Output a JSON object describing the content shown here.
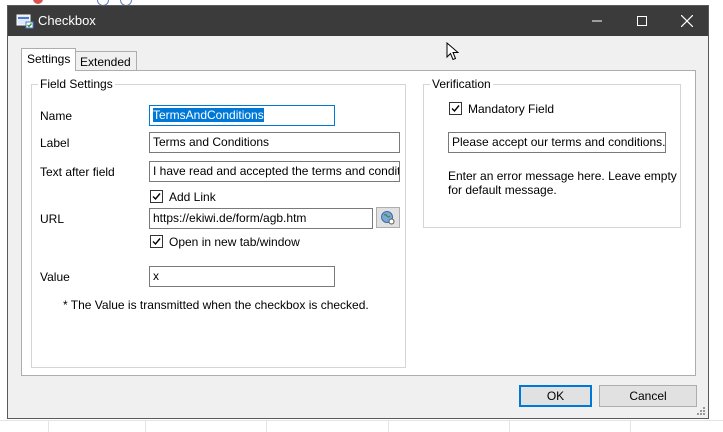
{
  "window": {
    "title": "Checkbox"
  },
  "tabs": [
    {
      "label": "Settings"
    },
    {
      "label": "Extended"
    }
  ],
  "field_settings": {
    "group_label": "Field Settings",
    "name": {
      "label": "Name",
      "value": "TermsAndConditions"
    },
    "label": {
      "label": "Label",
      "value": "Terms and Conditions"
    },
    "text_after": {
      "label": "Text after field",
      "value": "I have read and accepted the terms and conditions."
    },
    "add_link": {
      "label": "Add Link",
      "checked": true
    },
    "url": {
      "label": "URL",
      "value": "https://ekiwi.de/form/agb.htm"
    },
    "open_new_tab": {
      "label": "Open in new tab/window",
      "checked": true
    },
    "value": {
      "label": "Value",
      "value": "x"
    },
    "note": "* The Value is transmitted when the checkbox is checked."
  },
  "verification": {
    "group_label": "Verification",
    "mandatory": {
      "label": "Mandatory Field",
      "checked": true
    },
    "error_message": "Please accept our terms and conditions.",
    "hint_line1": "Enter an error message here. Leave empty",
    "hint_line2": "for default message."
  },
  "buttons": {
    "ok": "OK",
    "cancel": "Cancel"
  },
  "icons": {
    "app": "dialog-app-icon",
    "browse": "globe-browse-icon",
    "check": "check-mark-icon"
  },
  "colors": {
    "titlebar": "#3b3b3b",
    "accent": "#0078d7",
    "dialog_bg": "#f0f0f0"
  }
}
